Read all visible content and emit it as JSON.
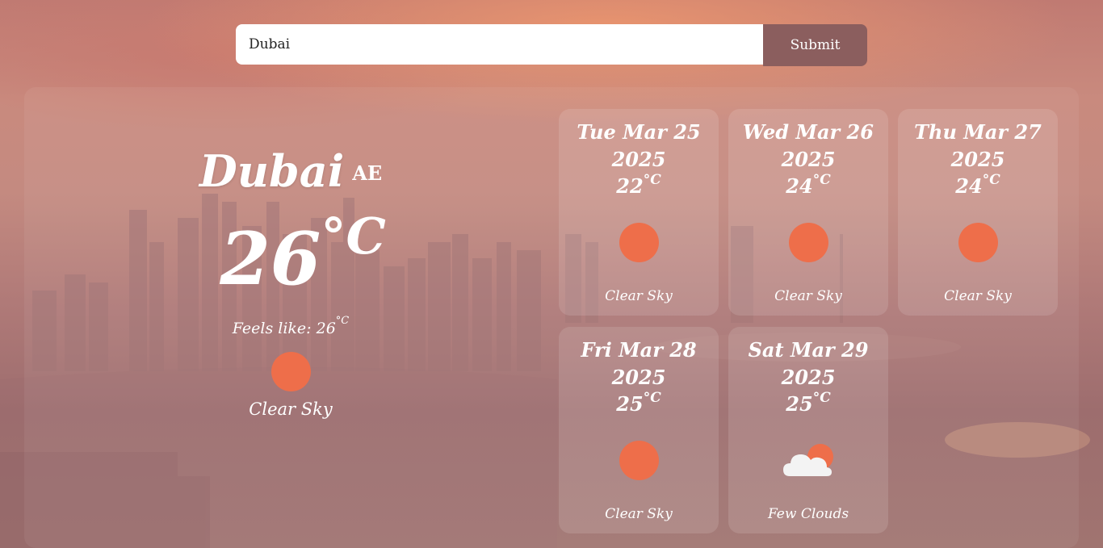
{
  "search": {
    "value": "Dubai",
    "submit_label": "Submit"
  },
  "current": {
    "city": "Dubai",
    "country": "AE",
    "temp": "26",
    "temp_unit": "°C",
    "feels_like_label": "Feels like: 26",
    "feels_like_unit": "°C",
    "icon": "sun-icon",
    "description": "Clear Sky"
  },
  "forecast": [
    {
      "date": "Tue Mar 25",
      "year": "2025",
      "temp": "22",
      "unit": "°C",
      "icon": "sun-icon",
      "description": "Clear Sky"
    },
    {
      "date": "Wed Mar 26",
      "year": "2025",
      "temp": "24",
      "unit": "°C",
      "icon": "sun-icon",
      "description": "Clear Sky"
    },
    {
      "date": "Thu Mar 27",
      "year": "2025",
      "temp": "24",
      "unit": "°C",
      "icon": "sun-icon",
      "description": "Clear Sky"
    },
    {
      "date": "Fri Mar 28",
      "year": "2025",
      "temp": "25",
      "unit": "°C",
      "icon": "sun-icon",
      "description": "Clear Sky"
    },
    {
      "date": "Sat Mar 29",
      "year": "2025",
      "temp": "25",
      "unit": "°C",
      "icon": "cloud-sun-icon",
      "description": "Few Clouds"
    }
  ],
  "colors": {
    "sun": "#ee6e4a",
    "submit_bg": "#8b5e5e"
  }
}
